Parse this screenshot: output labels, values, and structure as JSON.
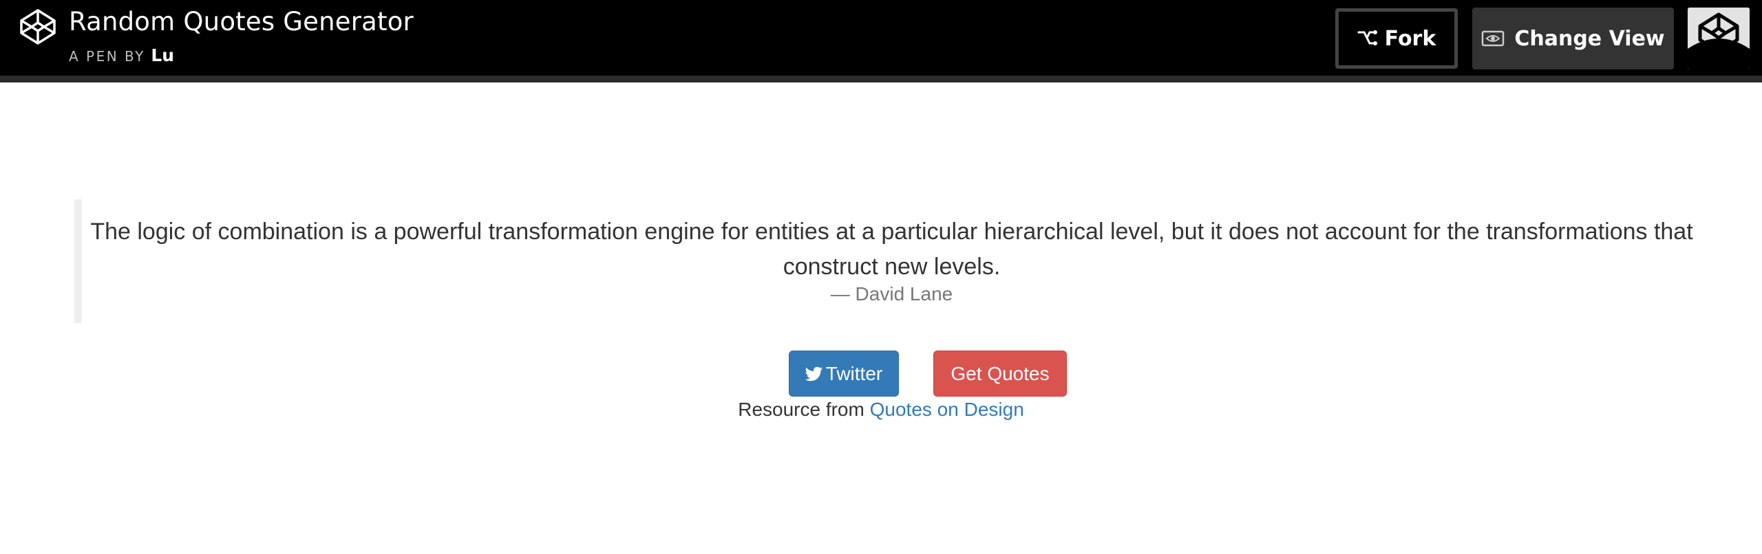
{
  "header": {
    "title": "Random Quotes Generator",
    "by_label": "A PEN BY",
    "author": "Lu",
    "fork_label": "Fork",
    "change_view_label": "Change View"
  },
  "quote": {
    "text": "The logic of combination is a powerful transformation engine for entities at a particular hierarchical level, but it does not account for the transformations that construct new levels.",
    "author": "— David Lane"
  },
  "actions": {
    "twitter_label": "Twitter",
    "get_quotes_label": "Get Quotes"
  },
  "footer": {
    "resource_prefix": "Resource from",
    "resource_link": "Quotes on Design"
  },
  "icons": {
    "logo": "codepen-logo-icon",
    "fork": "fork-icon",
    "change_view": "eye-icon",
    "avatar": "codepen-avatar-icon",
    "twitter": "twitter-bird-icon"
  },
  "colors": {
    "header_bg": "#000000",
    "twitter_btn": "#337ab7",
    "quotes_btn": "#d9534f",
    "link": "#337ab7"
  }
}
